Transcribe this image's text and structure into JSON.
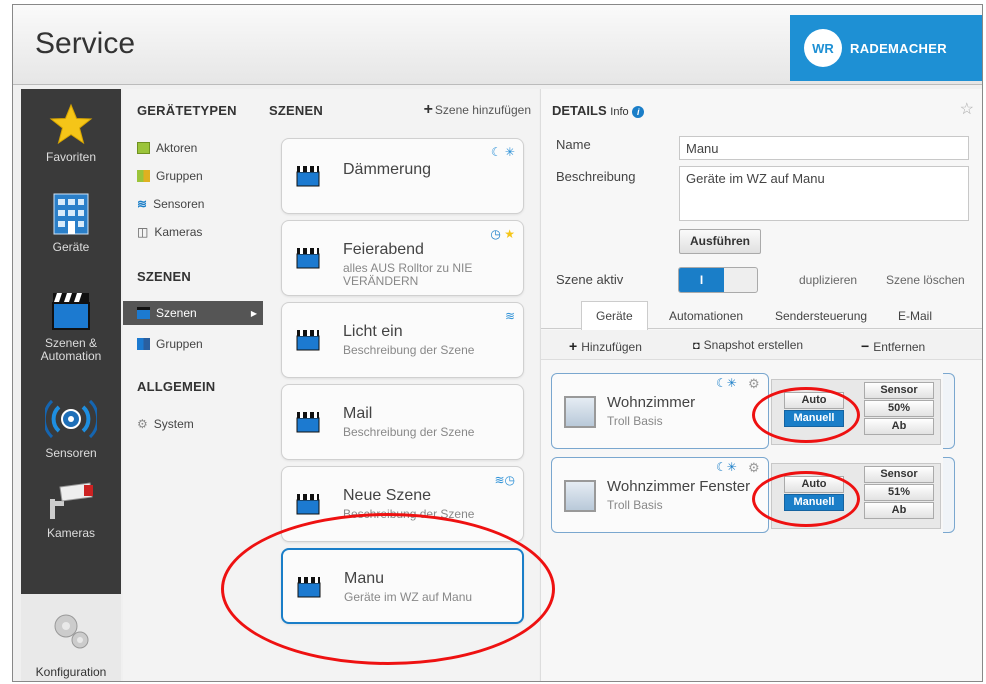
{
  "header": {
    "title": "Service",
    "logo_mark": "WR",
    "logo_text": "RADEMACHER"
  },
  "sidebar": {
    "items": [
      {
        "label": "Favoriten",
        "icon": "star-icon"
      },
      {
        "label": "Geräte",
        "icon": "building-icon"
      },
      {
        "label": "Szenen & Automation",
        "label1": "Szenen &",
        "label2": "Automation",
        "icon": "clapperboard-icon"
      },
      {
        "label": "Sensoren",
        "icon": "sensor-icon"
      },
      {
        "label": "Kameras",
        "icon": "camera-icon"
      }
    ],
    "config_label": "Konfiguration"
  },
  "types": {
    "geraetetypen_head": "GERÄTETYPEN",
    "geraetetypen": [
      "Aktoren",
      "Gruppen",
      "Sensoren",
      "Kameras"
    ],
    "szenen_head": "SZENEN",
    "szenen": [
      "Szenen",
      "Gruppen"
    ],
    "allgemein_head": "ALLGEMEIN",
    "allgemein": [
      "System"
    ]
  },
  "scenes": {
    "head": "SZENEN",
    "add_label": "Szene hinzufügen",
    "items": [
      {
        "title": "Dämmerung",
        "desc": ""
      },
      {
        "title": "Feierabend",
        "desc": "alles AUS Rolltor zu NIE VERÄNDERN"
      },
      {
        "title": "Licht ein",
        "desc": "Beschreibung der Szene"
      },
      {
        "title": "Mail",
        "desc": "Beschreibung der Szene"
      },
      {
        "title": "Neue Szene",
        "desc": "Beschreibung der Szene"
      },
      {
        "title": "Manu",
        "desc": "Geräte im WZ auf Manu"
      }
    ]
  },
  "details": {
    "head": "DETAILS",
    "info": "Info",
    "name_label": "Name",
    "name_value": "Manu",
    "desc_label": "Beschreibung",
    "desc_value": "Geräte im WZ auf Manu",
    "run_button": "Ausführen",
    "active_label": "Szene aktiv",
    "toggle_on": "I",
    "duplicate": "duplizieren",
    "delete": "Szene löschen",
    "tabs": [
      "Geräte",
      "Automationen",
      "Sendersteuerung",
      "E-Mail"
    ],
    "tools": {
      "add": "Hinzufügen",
      "snapshot": "Snapshot erstellen",
      "remove": "Entfernen"
    },
    "devices": [
      {
        "name": "Wohnzimmer",
        "type": "Troll Basis",
        "auto": "Auto",
        "manual": "Manuell",
        "sensor": "Sensor",
        "position": "50%",
        "direction": "Ab"
      },
      {
        "name": "Wohnzimmer Fenster",
        "type": "Troll Basis",
        "auto": "Auto",
        "manual": "Manuell",
        "sensor": "Sensor",
        "position": "51%",
        "direction": "Ab"
      }
    ]
  }
}
